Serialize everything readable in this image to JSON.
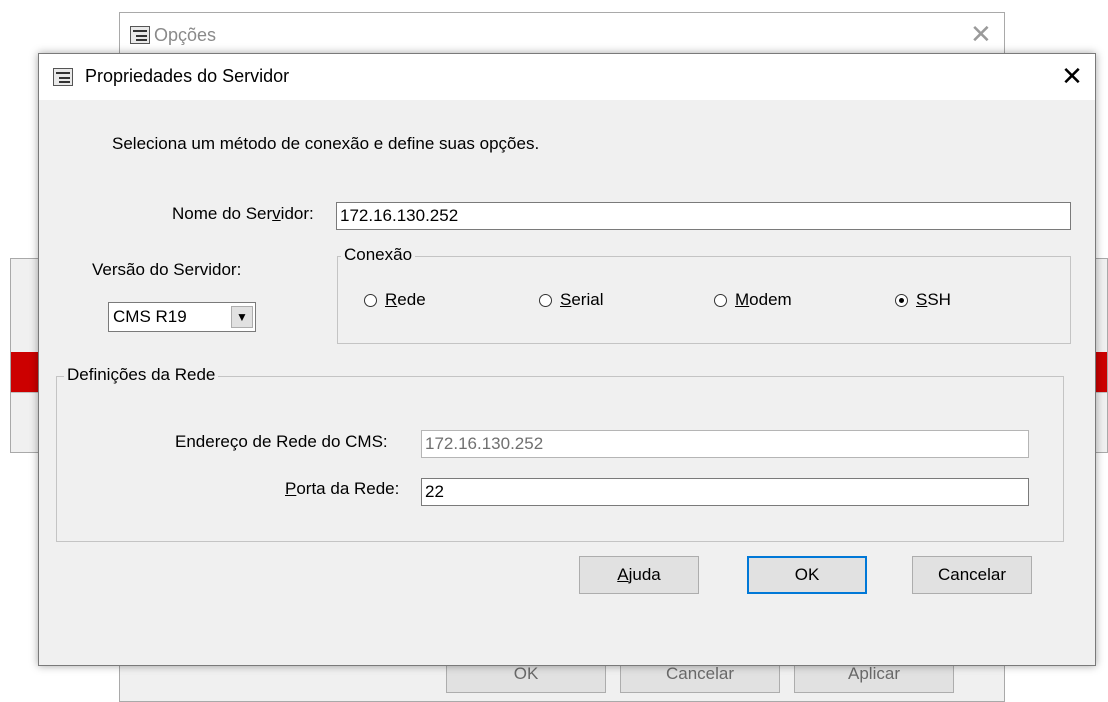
{
  "background_window": {
    "title": "Opções",
    "buttons": [
      "OK",
      "Cancelar",
      "Aplicar"
    ]
  },
  "dialog": {
    "title": "Propriedades do Servidor",
    "instruction": "Seleciona um método de conexão e define suas opções.",
    "server_name": {
      "label_pre": "Nome do Ser",
      "label_u": "v",
      "label_post": "idor:",
      "value": "172.16.130.252"
    },
    "server_version": {
      "label": "Versão do Servidor:",
      "value": "CMS R19"
    },
    "connection": {
      "legend": "Conexão",
      "options": [
        {
          "u": "R",
          "rest": "ede",
          "checked": false
        },
        {
          "u": "S",
          "rest": "erial",
          "checked": false
        },
        {
          "u": "M",
          "rest": "odem",
          "checked": false
        },
        {
          "u": "S",
          "rest": "SH",
          "checked": true
        }
      ]
    },
    "network": {
      "legend": "Definições da Rede",
      "address_label": "Endereço de Rede do CMS:",
      "address_value": "172.16.130.252",
      "port_label_u": "P",
      "port_label_rest": "orta da Rede:",
      "port_value": "22"
    },
    "buttons": {
      "help_u": "A",
      "help_rest": "juda",
      "ok": "OK",
      "cancel": "Cancelar"
    }
  }
}
